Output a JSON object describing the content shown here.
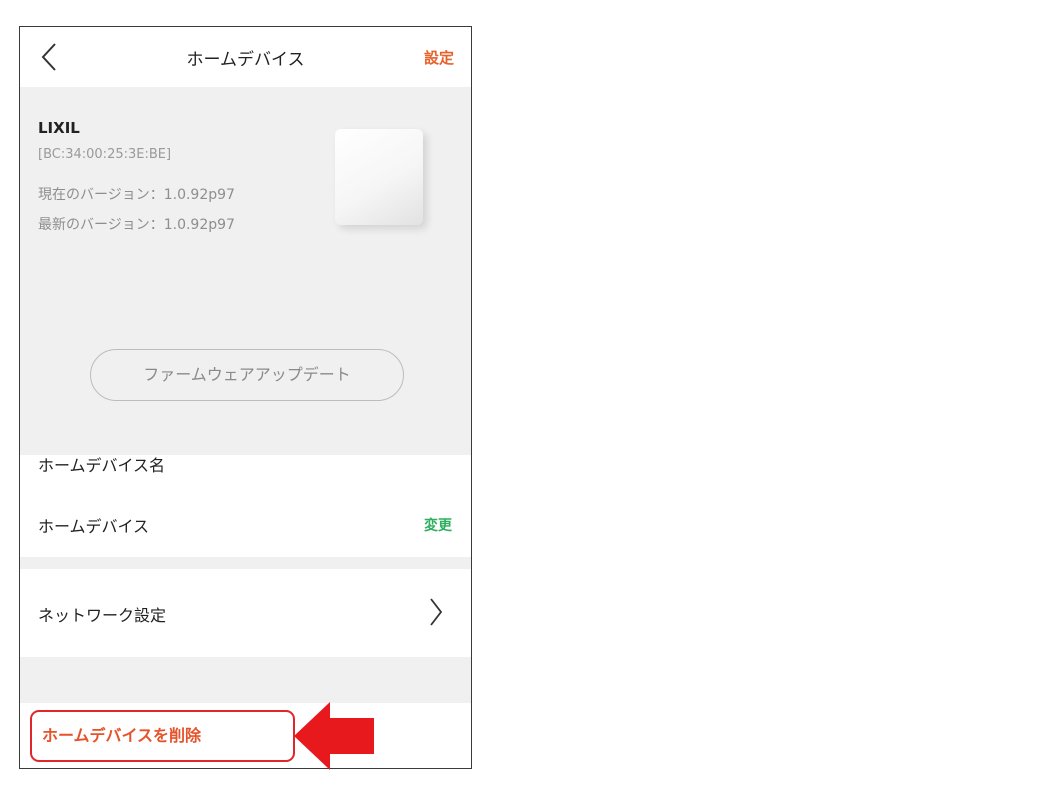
{
  "nav": {
    "title": "ホームデバイス",
    "settings_label": "設定"
  },
  "device": {
    "brand": "LIXIL",
    "mac": "[BC:34:00:25:3E:BE]",
    "current_version": "現在のバージョン：1.0.92p97",
    "latest_version": "最新のバージョン：1.0.92p97",
    "firmware_button_label": "ファームウェアアップデート"
  },
  "name_section": {
    "header": "ホームデバイス名",
    "name": "ホームデバイス",
    "change_label": "変更"
  },
  "network": {
    "label": "ネットワーク設定"
  },
  "delete": {
    "label": "ホームデバイスを削除"
  },
  "colors": {
    "accent_orange": "#e6622a",
    "change_green": "#2eae5f",
    "highlight_red": "#e0262b",
    "panel_gray": "#f0f0f0"
  },
  "icons": {
    "back": "chevron-left-icon",
    "network_disclosure": "chevron-right-icon",
    "pointer": "red-arrow-left"
  }
}
